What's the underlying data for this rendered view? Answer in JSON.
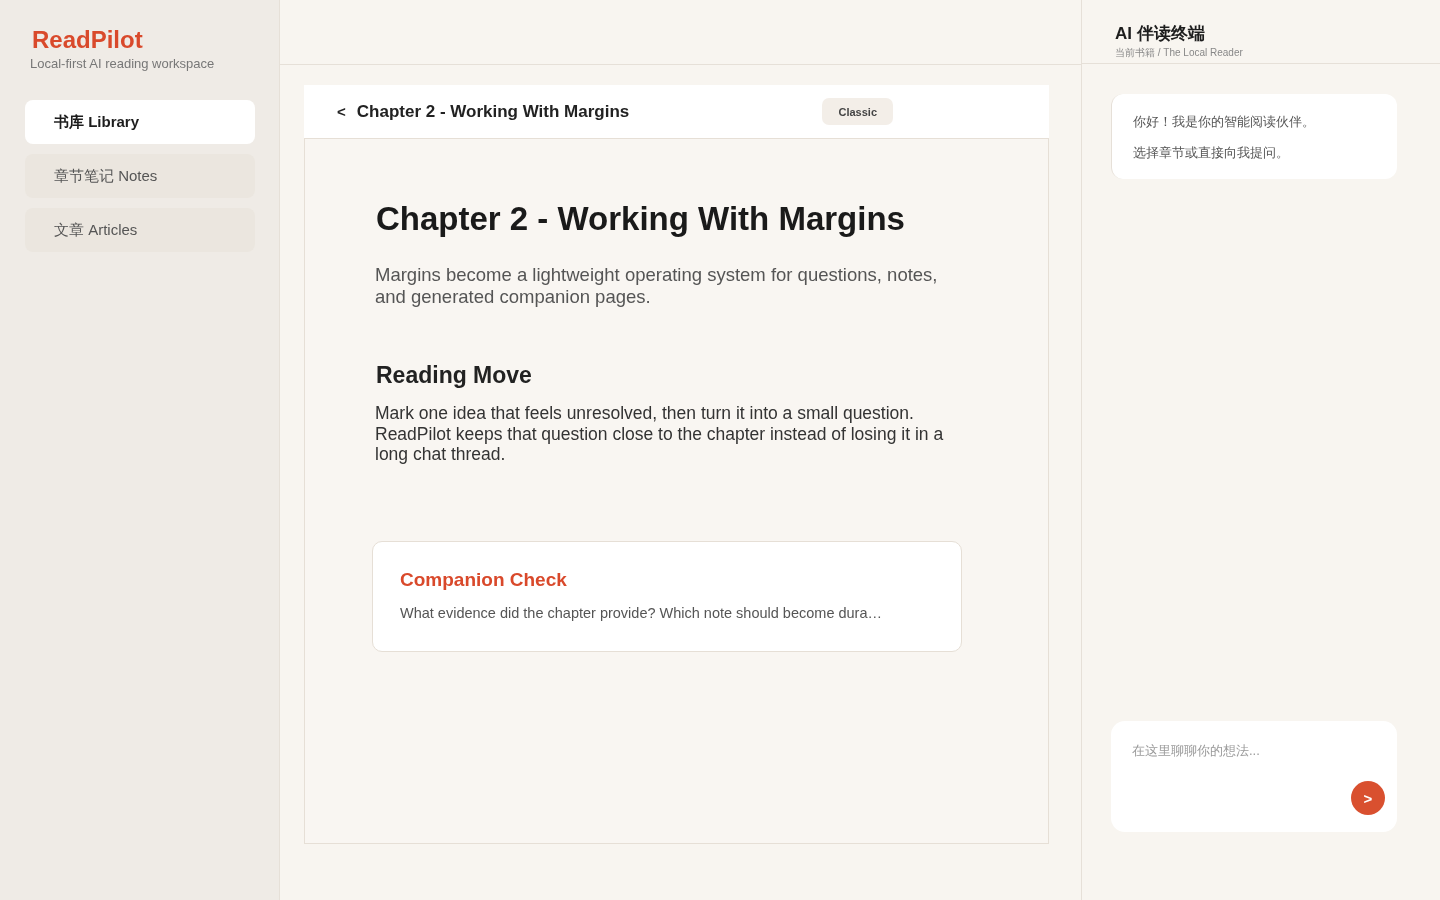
{
  "sidebar": {
    "brand": "ReadPilot",
    "tagline": "Local-first AI reading workspace",
    "items": [
      {
        "label": "书库 Library",
        "selected": true
      },
      {
        "label": "章节笔记 Notes",
        "selected": false
      },
      {
        "label": "文章 Articles",
        "selected": false
      }
    ]
  },
  "reader": {
    "back_button": "<",
    "title": "Chapter 2 - Working With Margins",
    "mode_button": "Classic",
    "chapter": {
      "heading": "Chapter 2 - Working With Margins",
      "lead": "Margins become a lightweight operating system for questions, notes, and generated companion pages.",
      "sections": [
        {
          "heading": "Reading Move",
          "body": "Mark one idea that feels unresolved, then turn it into a small question. ReadPilot keeps that question close to the chapter instead of losing it in a long chat thread."
        }
      ],
      "companion_check": {
        "title": "Companion Check",
        "text": "What evidence did the chapter provide? Which note should become dura…"
      }
    }
  },
  "assistant": {
    "title": "AI 伴读终端",
    "subtitle": "当前书籍 / The Local Reader",
    "messages": [
      {
        "kind": "assistant",
        "lines": [
          "你好！我是你的智能阅读伙伴。",
          "选择章节或直接向我提问。"
        ]
      }
    ],
    "input": {
      "placeholder": "在这里聊聊你的想法..."
    },
    "send_button": ">"
  }
}
